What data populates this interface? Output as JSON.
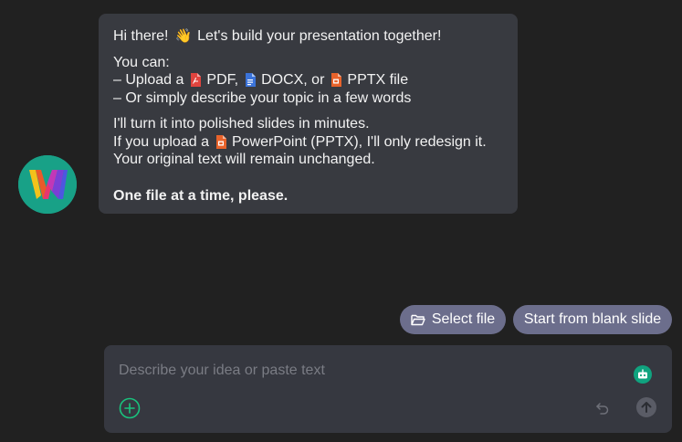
{
  "message": {
    "greeting": "Hi there!",
    "greeting_emoji": "👋",
    "greeting_rest": "Let's build your presentation together!",
    "you_can": "You can:",
    "upload_prefix": "– Upload a",
    "pdf_label": "PDF,",
    "docx_label": "DOCX, or",
    "pptx_label": "PPTX file",
    "describe_line": "– Or simply describe your topic in a few words",
    "turn_line": "I'll turn it into polished slides in minutes.",
    "upload_pp_prefix": "If you upload a",
    "upload_pp_rest": "PowerPoint (PPTX), I'll only redesign it.",
    "unchanged_line": "Your original text will remain unchanged.",
    "one_file": "One file at a time, please."
  },
  "chips": {
    "select_file": "Select file",
    "blank_slide": "Start from blank slide"
  },
  "composer": {
    "placeholder": "Describe your idea or paste text"
  },
  "icons": {
    "avatar": "logo-w-icon",
    "pdf": "pdf-file-icon",
    "docx": "docx-file-icon",
    "pptx": "pptx-file-icon",
    "folder": "folder-open-icon",
    "bot": "bot-icon",
    "add": "plus-circle-icon",
    "undo": "undo-icon",
    "send": "arrow-up-icon"
  },
  "colors": {
    "background": "#212121",
    "bubble": "#383a40",
    "chip": "#6c6e8c",
    "composer": "#363840",
    "accent_green": "#10a37f"
  }
}
